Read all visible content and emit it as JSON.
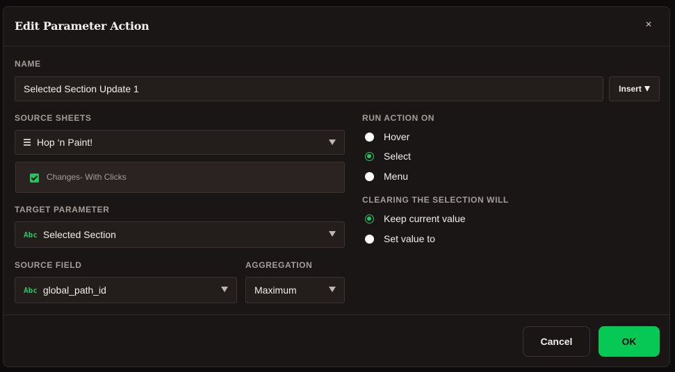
{
  "dialog": {
    "title": "Edit Parameter Action",
    "close_glyph": "×"
  },
  "name": {
    "label": "NAME",
    "value": "Selected Section Update 1",
    "insert_label": "Insert"
  },
  "source_sheets": {
    "label": "SOURCE SHEETS",
    "selected": "Hop ‘n Paint!",
    "items": [
      {
        "label": "Changes- With Clicks",
        "checked": true
      }
    ]
  },
  "target_parameter": {
    "label": "TARGET PARAMETER",
    "type_badge": "Abc",
    "value": "Selected Section"
  },
  "source_field": {
    "label": "SOURCE FIELD",
    "type_badge": "Abc",
    "value": "global_path_id"
  },
  "aggregation": {
    "label": "AGGREGATION",
    "value": "Maximum"
  },
  "run_action_on": {
    "label": "RUN ACTION ON",
    "options": [
      {
        "label": "Hover",
        "selected": false
      },
      {
        "label": "Select",
        "selected": true
      },
      {
        "label": "Menu",
        "selected": false
      }
    ]
  },
  "clearing": {
    "label": "CLEARING THE SELECTION WILL",
    "options": [
      {
        "label": "Keep current value",
        "selected": true
      },
      {
        "label": "Set value to",
        "selected": false
      }
    ]
  },
  "footer": {
    "cancel_label": "Cancel",
    "ok_label": "OK"
  },
  "colors": {
    "accent": "#22c55e",
    "ok_button": "#06c855",
    "background": "#1b1616"
  }
}
